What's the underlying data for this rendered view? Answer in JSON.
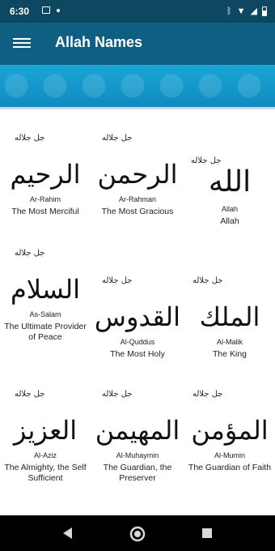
{
  "status_bar": {
    "time": "6:30",
    "left_icons": [
      "image-icon",
      "dot-icon"
    ],
    "right_icons": [
      "bluetooth-icon",
      "wifi-icon",
      "signal-icon",
      "battery-icon"
    ]
  },
  "app_bar": {
    "menu_icon": "hamburger-menu-icon",
    "title": "Allah Names"
  },
  "names": [
    {
      "arabic": "الرحيم",
      "translit": "Ar-Rahim",
      "meaning": "The Most Merciful",
      "honorific": "جل جلاله"
    },
    {
      "arabic": "الرحمن",
      "translit": "Ar-Rahman",
      "meaning": "The Most Gracious",
      "honorific": "جل جلاله"
    },
    {
      "arabic": "الله",
      "translit": "Allah",
      "meaning": "Allah",
      "honorific": "جل جلاله"
    },
    {
      "arabic": "السلام",
      "translit": "As-Salam",
      "meaning": "The Ultimate Provider of Peace",
      "honorific": "جل جلاله"
    },
    {
      "arabic": "القدوس",
      "translit": "Al-Quddus",
      "meaning": "The Most Holy",
      "honorific": "جل جلاله"
    },
    {
      "arabic": "الملك",
      "translit": "Al-Malik",
      "meaning": "The King",
      "honorific": "جل جلاله"
    },
    {
      "arabic": "العزيز",
      "translit": "Al-Aziz",
      "meaning": "The Almighty, the Self Sufficient",
      "honorific": "جل جلاله"
    },
    {
      "arabic": "المهيمن",
      "translit": "Al-Muhaymin",
      "meaning": "The Guardian, the Preserver",
      "honorific": "جل جلاله"
    },
    {
      "arabic": "المؤمن",
      "translit": "Al-Mumin",
      "meaning": "The Guardian of Faith",
      "honorific": "جل جلاله"
    }
  ],
  "nav_bar": {
    "icons": [
      "back-icon",
      "home-icon",
      "recents-icon"
    ]
  }
}
